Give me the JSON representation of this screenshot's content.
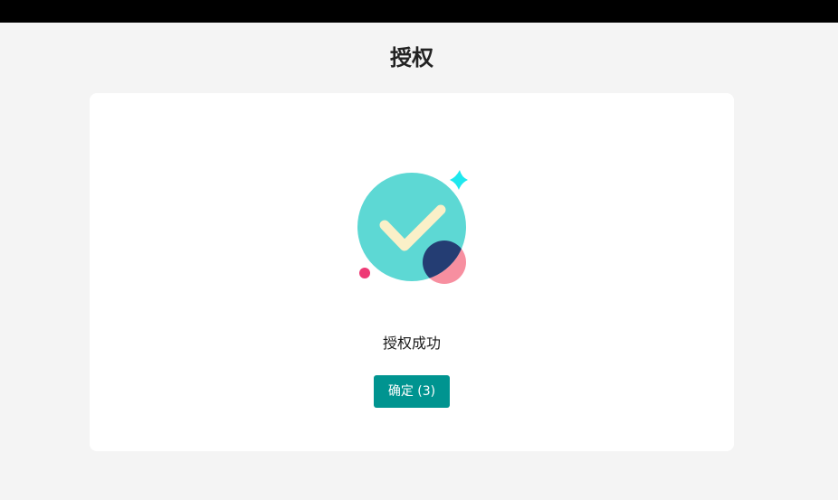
{
  "page": {
    "title": "授权"
  },
  "result": {
    "icon": "success-check-illustration",
    "message": "授权成功",
    "confirm_label": "确定",
    "countdown": "(3)"
  },
  "colors": {
    "primary": "#009490",
    "circle": "#5dd8d4",
    "check": "#faf0c8",
    "accent_navy": "#243d73",
    "accent_pink": "#f78fa0",
    "sparkle": "#1ee8ee",
    "dot": "#ee3a75"
  }
}
